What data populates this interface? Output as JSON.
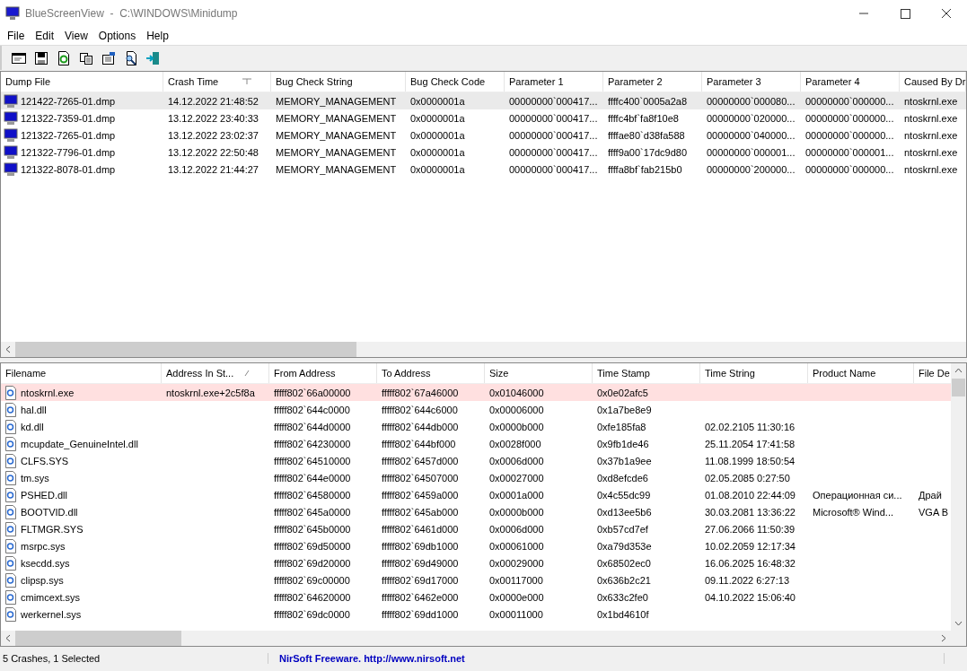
{
  "window": {
    "title": "BlueScreenView  -  C:\\WINDOWS\\Minidump"
  },
  "menu": [
    "File",
    "Edit",
    "View",
    "Options",
    "Help"
  ],
  "crashes": {
    "columns": [
      {
        "label": "Dump File",
        "sorted": false
      },
      {
        "label": "Crash Time",
        "sorted": true
      },
      {
        "label": "Bug Check String",
        "sorted": false
      },
      {
        "label": "Bug Check Code",
        "sorted": false
      },
      {
        "label": "Parameter 1",
        "sorted": false
      },
      {
        "label": "Parameter 2",
        "sorted": false
      },
      {
        "label": "Parameter 3",
        "sorted": false
      },
      {
        "label": "Parameter 4",
        "sorted": false
      },
      {
        "label": "Caused By Dr",
        "sorted": false
      }
    ],
    "rows": [
      {
        "selected": true,
        "cells": [
          "121422-7265-01.dmp",
          "14.12.2022 21:48:52",
          "MEMORY_MANAGEMENT",
          "0x0000001a",
          "00000000`000417...",
          "ffffc400`0005a2a8",
          "00000000`000080...",
          "00000000`000000...",
          "ntoskrnl.exe"
        ]
      },
      {
        "selected": false,
        "cells": [
          "121322-7359-01.dmp",
          "13.12.2022 23:40:33",
          "MEMORY_MANAGEMENT",
          "0x0000001a",
          "00000000`000417...",
          "ffffc4bf`fa8f10e8",
          "00000000`020000...",
          "00000000`000000...",
          "ntoskrnl.exe"
        ]
      },
      {
        "selected": false,
        "cells": [
          "121322-7265-01.dmp",
          "13.12.2022 23:02:37",
          "MEMORY_MANAGEMENT",
          "0x0000001a",
          "00000000`000417...",
          "ffffae80`d38fa588",
          "00000000`040000...",
          "00000000`000000...",
          "ntoskrnl.exe"
        ]
      },
      {
        "selected": false,
        "cells": [
          "121322-7796-01.dmp",
          "13.12.2022 22:50:48",
          "MEMORY_MANAGEMENT",
          "0x0000001a",
          "00000000`000417...",
          "ffff9a00`17dc9d80",
          "00000000`000001...",
          "00000000`000001...",
          "ntoskrnl.exe"
        ]
      },
      {
        "selected": false,
        "cells": [
          "121322-8078-01.dmp",
          "13.12.2022 21:44:27",
          "MEMORY_MANAGEMENT",
          "0x0000001a",
          "00000000`000417...",
          "ffffa8bf`fab215b0",
          "00000000`200000...",
          "00000000`000000...",
          "ntoskrnl.exe"
        ]
      }
    ]
  },
  "modules": {
    "columns": [
      {
        "label": "Filename",
        "sorted": false
      },
      {
        "label": "Address In St...",
        "sorted": true
      },
      {
        "label": "From Address",
        "sorted": false
      },
      {
        "label": "To Address",
        "sorted": false
      },
      {
        "label": "Size",
        "sorted": false
      },
      {
        "label": "Time Stamp",
        "sorted": false
      },
      {
        "label": "Time String",
        "sorted": false
      },
      {
        "label": "Product Name",
        "sorted": false
      },
      {
        "label": "File De",
        "sorted": false
      }
    ],
    "rows": [
      {
        "highlighted": true,
        "cells": [
          "ntoskrnl.exe",
          "ntoskrnl.exe+2c5f8a",
          "fffff802`66a00000",
          "fffff802`67a46000",
          "0x01046000",
          "0x0e02afc5",
          "",
          "",
          ""
        ]
      },
      {
        "highlighted": false,
        "cells": [
          "hal.dll",
          "",
          "fffff802`644c0000",
          "fffff802`644c6000",
          "0x00006000",
          "0x1a7be8e9",
          "",
          "",
          ""
        ]
      },
      {
        "highlighted": false,
        "cells": [
          "kd.dll",
          "",
          "fffff802`644d0000",
          "fffff802`644db000",
          "0x0000b000",
          "0xfe185fa8",
          "02.02.2105 11:30:16",
          "",
          ""
        ]
      },
      {
        "highlighted": false,
        "cells": [
          "mcupdate_GenuineIntel.dll",
          "",
          "fffff802`64230000",
          "fffff802`644bf000",
          "0x0028f000",
          "0x9fb1de46",
          "25.11.2054 17:41:58",
          "",
          ""
        ]
      },
      {
        "highlighted": false,
        "cells": [
          "CLFS.SYS",
          "",
          "fffff802`64510000",
          "fffff802`6457d000",
          "0x0006d000",
          "0x37b1a9ee",
          "11.08.1999 18:50:54",
          "",
          ""
        ]
      },
      {
        "highlighted": false,
        "cells": [
          "tm.sys",
          "",
          "fffff802`644e0000",
          "fffff802`64507000",
          "0x00027000",
          "0xd8efcde6",
          "02.05.2085 0:27:50",
          "",
          ""
        ]
      },
      {
        "highlighted": false,
        "cells": [
          "PSHED.dll",
          "",
          "fffff802`64580000",
          "fffff802`6459a000",
          "0x0001a000",
          "0x4c55dc99",
          "01.08.2010 22:44:09",
          "Операционная си...",
          "Драй"
        ]
      },
      {
        "highlighted": false,
        "cells": [
          "BOOTVID.dll",
          "",
          "fffff802`645a0000",
          "fffff802`645ab000",
          "0x0000b000",
          "0xd13ee5b6",
          "30.03.2081 13:36:22",
          "Microsoft® Wind...",
          "VGA B"
        ]
      },
      {
        "highlighted": false,
        "cells": [
          "FLTMGR.SYS",
          "",
          "fffff802`645b0000",
          "fffff802`6461d000",
          "0x0006d000",
          "0xb57cd7ef",
          "27.06.2066 11:50:39",
          "",
          ""
        ]
      },
      {
        "highlighted": false,
        "cells": [
          "msrpc.sys",
          "",
          "fffff802`69d50000",
          "fffff802`69db1000",
          "0x00061000",
          "0xa79d353e",
          "10.02.2059 12:17:34",
          "",
          ""
        ]
      },
      {
        "highlighted": false,
        "cells": [
          "ksecdd.sys",
          "",
          "fffff802`69d20000",
          "fffff802`69d49000",
          "0x00029000",
          "0x68502ec0",
          "16.06.2025 16:48:32",
          "",
          ""
        ]
      },
      {
        "highlighted": false,
        "cells": [
          "clipsp.sys",
          "",
          "fffff802`69c00000",
          "fffff802`69d17000",
          "0x00117000",
          "0x636b2c21",
          "09.11.2022 6:27:13",
          "",
          ""
        ]
      },
      {
        "highlighted": false,
        "cells": [
          "cmimcext.sys",
          "",
          "fffff802`64620000",
          "fffff802`6462e000",
          "0x0000e000",
          "0x633c2fe0",
          "04.10.2022 15:06:40",
          "",
          ""
        ]
      },
      {
        "highlighted": false,
        "cells": [
          "werkernel.sys",
          "",
          "fffff802`69dc0000",
          "fffff802`69dd1000",
          "0x00011000",
          "0x1bd4610f",
          "",
          "",
          ""
        ]
      }
    ]
  },
  "status": {
    "summary": "5 Crashes, 1 Selected",
    "credit": "NirSoft Freeware.  http://www.nirsoft.net"
  }
}
